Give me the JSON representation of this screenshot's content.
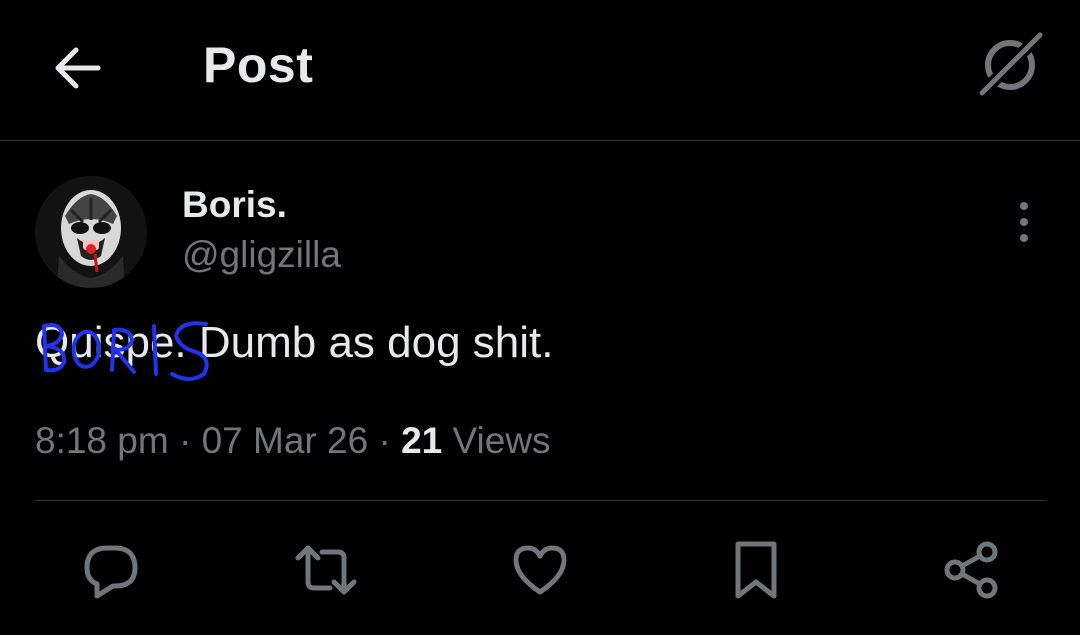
{
  "header": {
    "title": "Post",
    "back_icon": "arrow-left-icon",
    "grok_icon": "grok-icon"
  },
  "post": {
    "author": {
      "display_name": "Boris.",
      "handle": "@gligzilla",
      "avatar": "masked-luchador-avatar"
    },
    "text_prefix": "Quispe",
    "text_rest": ". Dumb as dog shit.",
    "overlay_scribble": "BORIS",
    "time": "8:18 pm",
    "separator": "·",
    "date": "07 Mar 26",
    "views_count": "21",
    "views_label": "Views"
  },
  "actions": {
    "reply_icon": "reply-icon",
    "repost_icon": "repost-icon",
    "like_icon": "heart-icon",
    "bookmark_icon": "bookmark-icon",
    "share_icon": "share-icon"
  },
  "colors": {
    "background": "#000000",
    "primary_text": "#e7e9ea",
    "secondary_text": "#71767b",
    "divider": "#2f3336",
    "scribble_ink": "#2233ee"
  }
}
